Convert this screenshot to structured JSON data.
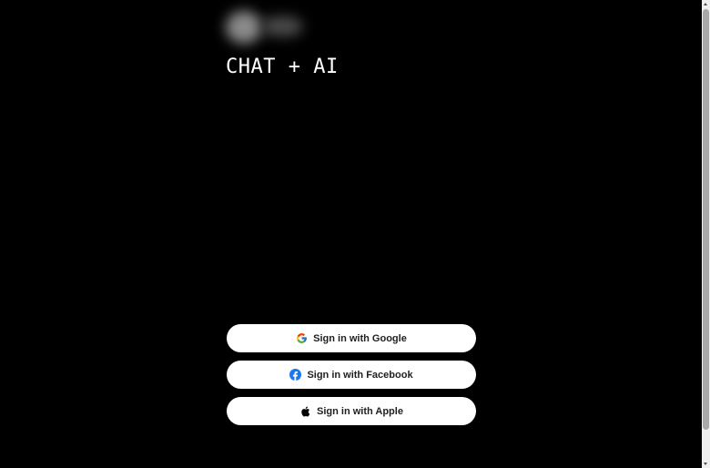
{
  "app": {
    "title": "CHAT + AI",
    "logo": "blurred-logo"
  },
  "auth": {
    "google": {
      "label": "Sign in with Google",
      "icon": "google-icon"
    },
    "facebook": {
      "label": "Sign in with Facebook",
      "icon": "facebook-icon"
    },
    "apple": {
      "label": "Sign in with Apple",
      "icon": "apple-icon"
    }
  },
  "colors": {
    "background": "#000000",
    "button_background": "#ffffff",
    "button_text": "#1f1f1f",
    "facebook_blue": "#1877F2"
  }
}
